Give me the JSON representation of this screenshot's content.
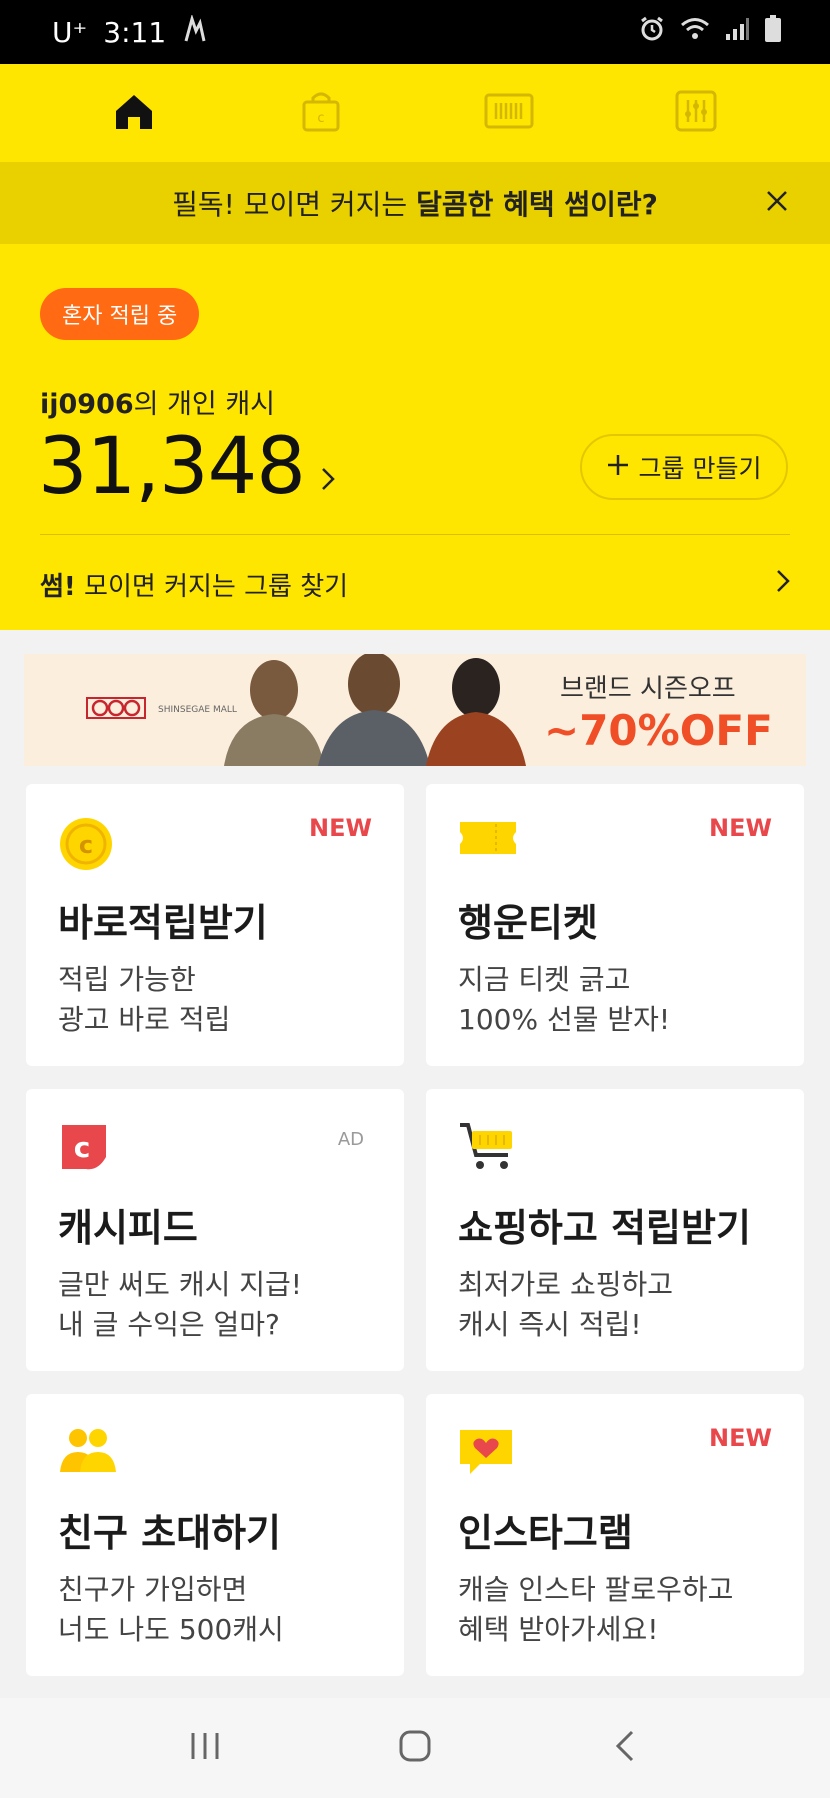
{
  "status_bar": {
    "carrier": "U⁺",
    "time": "3:11",
    "icons": [
      "activity-icon",
      "alarm-icon",
      "wifi-icon",
      "signal-icon",
      "battery-icon"
    ]
  },
  "top_nav": {
    "items": [
      "home-icon",
      "shop-bag-icon",
      "barcode-icon",
      "settings-sliders-icon"
    ]
  },
  "notice": {
    "prefix": "필독! 모이면 커지는 ",
    "bold": "달콤한 혜택 썸이란?"
  },
  "hero": {
    "badge": "혼자 적립 중",
    "owner": "ij0906",
    "owner_suffix": "의 개인 캐시",
    "amount": "31,348",
    "group_button": "그룹 만들기",
    "find_group_bold": "썸!",
    "find_group_text": " 모이면 커지는 그룹 찾기"
  },
  "ad_banner": {
    "brand": "SHINSEGAE MALL",
    "headline": "브랜드 시즌오프",
    "offer": "~70%OFF"
  },
  "cards": [
    {
      "title": "바로적립받기",
      "line1": "적립 가능한",
      "line2": "광고 바로 적립",
      "tag": "NEW",
      "icon": "cash-coin-icon"
    },
    {
      "title": "행운티켓",
      "line1": "지금 티켓 긁고",
      "line2": "100% 선물 받자!",
      "tag": "NEW",
      "icon": "ticket-icon"
    },
    {
      "title": "캐시피드",
      "line1": "글만 써도 캐시 지급!",
      "line2": "내 글 수익은 얼마?",
      "tag": "AD",
      "icon": "cashfeed-icon"
    },
    {
      "title": "쇼핑하고 적립받기",
      "line1": "최저가로 쇼핑하고",
      "line2": "캐시 즉시 적립!",
      "tag": "",
      "icon": "cart-icon"
    },
    {
      "title": "친구 초대하기",
      "line1": "친구가 가입하면",
      "line2": "너도 나도 500캐시",
      "tag": "",
      "icon": "friends-icon"
    },
    {
      "title": "인스타그램",
      "line1": "캐슬 인스타 팔로우하고",
      "line2": "혜택 받아가세요!",
      "tag": "NEW",
      "icon": "heart-chat-icon"
    }
  ],
  "bottom_nav": [
    "recent-apps-icon",
    "home-button-icon",
    "back-icon"
  ],
  "colors": {
    "yellow": "#ffe600",
    "orange_badge": "#ff6a13",
    "new_red": "#e8484b"
  }
}
